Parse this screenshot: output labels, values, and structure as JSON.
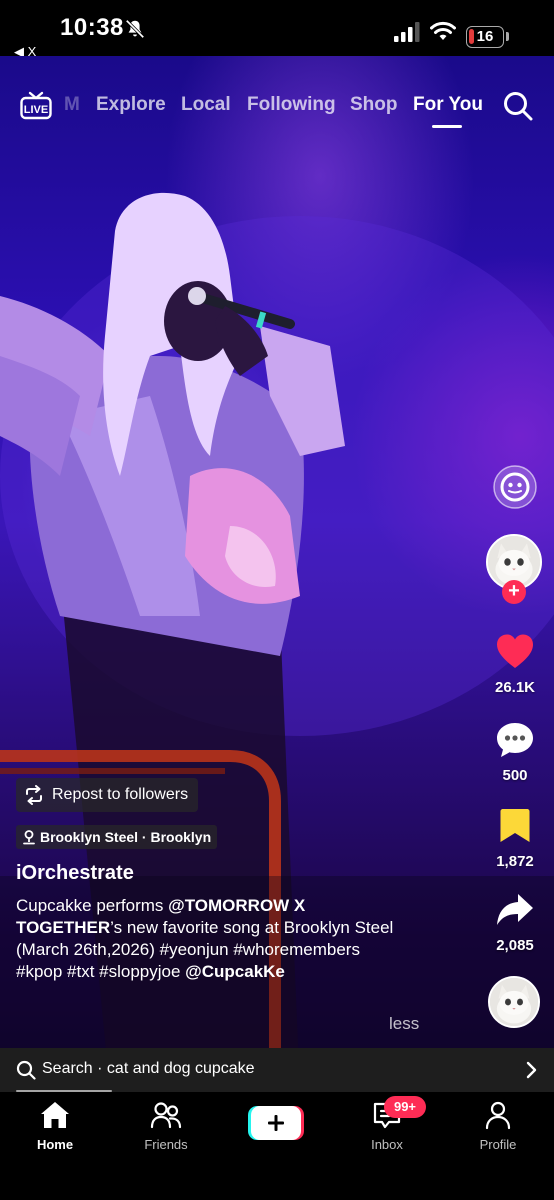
{
  "status_bar": {
    "time": "10:38",
    "back_app_label": "X",
    "battery_level": "16",
    "battery_fraction": 0.16,
    "battery_color": "#e23b3b"
  },
  "top_nav": {
    "live_label": "LIVE",
    "faded_tab": "M",
    "tabs": [
      {
        "label": "Explore"
      },
      {
        "label": "Local"
      },
      {
        "label": "Following"
      },
      {
        "label": "Shop"
      },
      {
        "label": "For You"
      }
    ],
    "active_tab": "For You"
  },
  "rail": {
    "likes": "26.1K",
    "comments": "500",
    "saves": "1,872",
    "shares": "2,085",
    "like_color": "#fe2c55",
    "save_color": "#fcd838"
  },
  "caption": {
    "repost_label": "Repost to followers",
    "location": "Brooklyn Steel · Brooklyn",
    "username": "iOrchestrate",
    "text_before": "Cupcakke performs ",
    "mention_1": "@TOMORROW X TOGETHER",
    "text_after": "’s new favorite song at Brooklyn Steel (March 26th,2026) #yeonjun #whoremembers #kpop #txt #sloppyjoe ",
    "mention_2": "@CupcakKe",
    "less_label": "less"
  },
  "search_suggestion": {
    "text": "Search · cat and dog cupcake"
  },
  "tab_bar": {
    "home": "Home",
    "friends": "Friends",
    "inbox": "Inbox",
    "inbox_badge": "99+",
    "profile": "Profile"
  }
}
